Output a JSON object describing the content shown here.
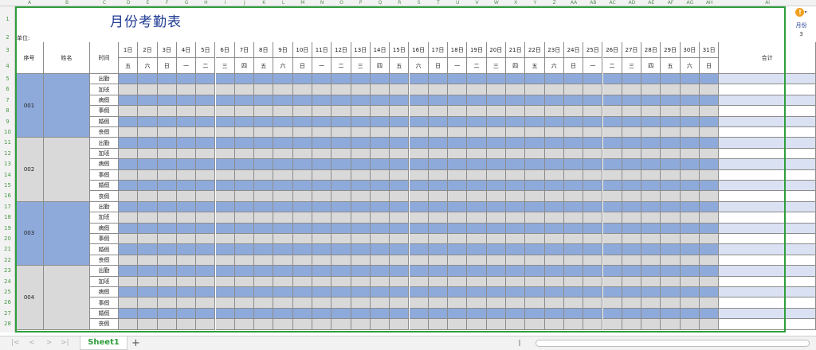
{
  "sheet": {
    "column_letters": [
      "A",
      "B",
      "C",
      "D",
      "E",
      "F",
      "G",
      "H",
      "I",
      "J",
      "K",
      "L",
      "M",
      "N",
      "O",
      "P",
      "Q",
      "R",
      "S",
      "T",
      "U",
      "V",
      "W",
      "X",
      "Y",
      "Z",
      "AA",
      "AB",
      "AC",
      "AD",
      "AE",
      "AF",
      "AG",
      "AH",
      "AI"
    ],
    "title": "月份考勤表",
    "unit_label": "单位:",
    "headers": {
      "seq": "序号",
      "name": "姓名",
      "time": "时间",
      "total": "合计"
    },
    "days": [
      "1日",
      "2日",
      "3日",
      "4日",
      "5日",
      "6日",
      "7日",
      "8日",
      "9日",
      "10日",
      "11日",
      "12日",
      "13日",
      "14日",
      "15日",
      "16日",
      "17日",
      "18日",
      "19日",
      "20日",
      "21日",
      "22日",
      "23日",
      "24日",
      "25日",
      "26日",
      "27日",
      "28日",
      "29日",
      "30日",
      "31日"
    ],
    "weekdays": [
      "五",
      "六",
      "日",
      "一",
      "二",
      "三",
      "四",
      "五",
      "六",
      "日",
      "一",
      "二",
      "三",
      "四",
      "五",
      "六",
      "日",
      "一",
      "二",
      "三",
      "四",
      "五",
      "六",
      "日",
      "一",
      "二",
      "三",
      "四",
      "五",
      "六",
      "日"
    ],
    "categories": [
      "出勤",
      "加班",
      "病假",
      "事假",
      "婚假",
      "丧假"
    ],
    "employees": [
      "001",
      "002",
      "003",
      "004"
    ]
  },
  "side_panel": {
    "warn_icon": "!",
    "caret": "▾",
    "month_label": "月份",
    "month_value": "3"
  },
  "tabs": {
    "nav": [
      "|<",
      "<",
      ">",
      ">|"
    ],
    "sheet_name": "Sheet1",
    "add_label": "+",
    "scroll_sep": "‖"
  }
}
